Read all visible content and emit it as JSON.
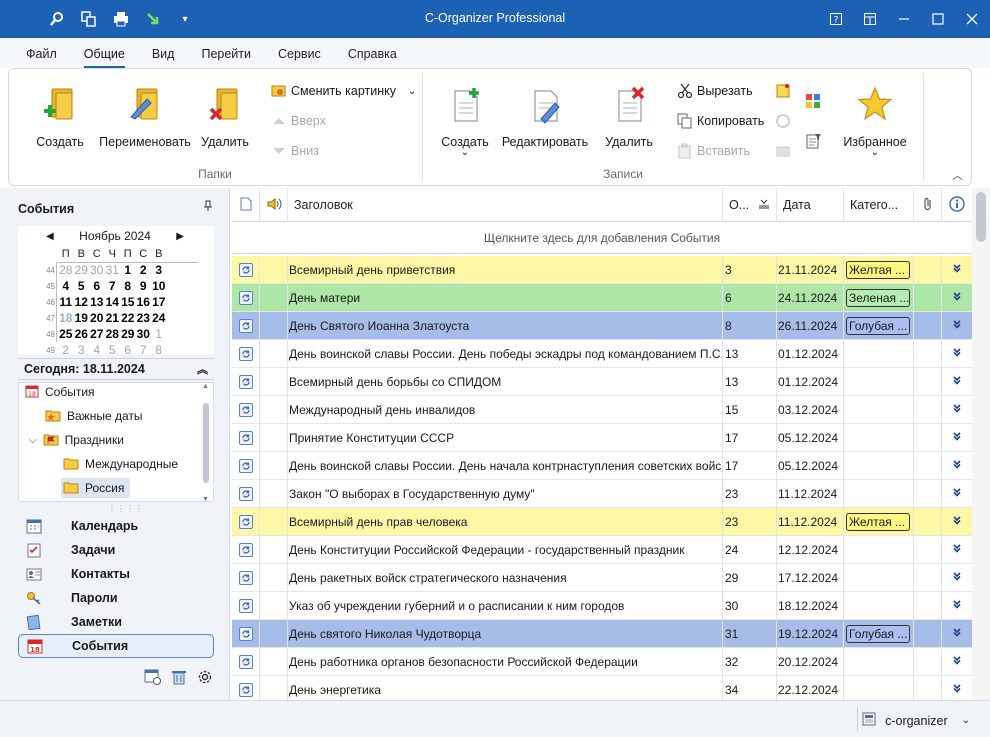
{
  "window": {
    "title": "C-Organizer Professional"
  },
  "menu": [
    {
      "label": "Файл",
      "active": false
    },
    {
      "label": "Общие",
      "active": true
    },
    {
      "label": "Вид",
      "active": false
    },
    {
      "label": "Перейти",
      "active": false
    },
    {
      "label": "Сервис",
      "active": false
    },
    {
      "label": "Справка",
      "active": false
    }
  ],
  "ribbon": {
    "folders": {
      "label": "Папки",
      "create": "Создать",
      "rename": "Переименовать",
      "delete": "Удалить",
      "change_picture": "Сменить картинку",
      "up": "Вверх",
      "down": "Вниз"
    },
    "records": {
      "label": "Записи",
      "create": "Создать",
      "edit": "Редактировать",
      "delete": "Удалить",
      "cut": "Вырезать",
      "copy": "Копировать",
      "paste": "Вставить"
    },
    "favorites": "Избранное"
  },
  "left": {
    "title": "События",
    "calendar": {
      "month": "Ноябрь 2024",
      "weekdays": [
        "П",
        "В",
        "С",
        "Ч",
        "П",
        "С",
        "В"
      ],
      "weeks": [
        {
          "num": "44",
          "days": [
            [
              "28",
              "g"
            ],
            [
              "29",
              "g"
            ],
            [
              "30",
              "g"
            ],
            [
              "31",
              "g"
            ],
            [
              "1",
              "b"
            ],
            [
              "2",
              "b"
            ],
            [
              "3",
              "b"
            ]
          ]
        },
        {
          "num": "45",
          "days": [
            [
              "4",
              "b"
            ],
            [
              "5",
              "b"
            ],
            [
              "6",
              "b"
            ],
            [
              "7",
              "b"
            ],
            [
              "8",
              "b"
            ],
            [
              "9",
              "b"
            ],
            [
              "10",
              "b"
            ]
          ]
        },
        {
          "num": "46",
          "days": [
            [
              "11",
              "b"
            ],
            [
              "12",
              "b"
            ],
            [
              "13",
              "b"
            ],
            [
              "14",
              "b"
            ],
            [
              "15",
              "b"
            ],
            [
              "16",
              "b"
            ],
            [
              "17",
              "b"
            ]
          ]
        },
        {
          "num": "47",
          "days": [
            [
              "18",
              "t"
            ],
            [
              "19",
              "b"
            ],
            [
              "20",
              "b"
            ],
            [
              "21",
              "b"
            ],
            [
              "22",
              "b"
            ],
            [
              "23",
              "b"
            ],
            [
              "24",
              "b"
            ]
          ]
        },
        {
          "num": "48",
          "days": [
            [
              "25",
              "b"
            ],
            [
              "26",
              "b"
            ],
            [
              "27",
              "b"
            ],
            [
              "28",
              "b"
            ],
            [
              "29",
              "b"
            ],
            [
              "30",
              "b"
            ],
            [
              "1",
              "g"
            ]
          ]
        },
        {
          "num": "49",
          "days": [
            [
              "2",
              "g"
            ],
            [
              "3",
              "g"
            ],
            [
              "4",
              "g"
            ],
            [
              "5",
              "g"
            ],
            [
              "6",
              "g"
            ],
            [
              "7",
              "g"
            ],
            [
              "8",
              "g"
            ]
          ]
        }
      ]
    },
    "today": "Сегодня: 18.11.2024",
    "tree": {
      "events": "События",
      "important": "Важные даты",
      "holidays": "Праздники",
      "international": "Международные",
      "russia": "Россия"
    },
    "nav": [
      {
        "label": "Календарь",
        "selected": false
      },
      {
        "label": "Задачи",
        "selected": false
      },
      {
        "label": "Контакты",
        "selected": false
      },
      {
        "label": "Пароли",
        "selected": false
      },
      {
        "label": "Заметки",
        "selected": false
      },
      {
        "label": "События",
        "selected": true
      }
    ]
  },
  "grid": {
    "headers": {
      "title": "Заголовок",
      "order": "О...",
      "date": "Дата",
      "category": "Катего..."
    },
    "add_row": "Щелкните здесь для добавления События",
    "rows": [
      {
        "title": "Всемирный день приветствия",
        "order": "3",
        "date": "21.11.2024",
        "category": "Желтая ...",
        "color": "yellow"
      },
      {
        "title": "День матери",
        "order": "6",
        "date": "24.11.2024",
        "category": "Зеленая ...",
        "color": "green"
      },
      {
        "title": "День Святого Иоанна Златоуста",
        "order": "8",
        "date": "26.11.2024",
        "category": "Голубая ...",
        "color": "blue"
      },
      {
        "title": "День воинской славы России. День победы эскадры под командованием П.С. На...",
        "order": "13",
        "date": "01.12.2024",
        "category": "",
        "color": ""
      },
      {
        "title": "Всемирный день борьбы со СПИДОМ",
        "order": "13",
        "date": "01.12.2024",
        "category": "",
        "color": ""
      },
      {
        "title": "Международный день инвалидов",
        "order": "15",
        "date": "03.12.2024",
        "category": "",
        "color": ""
      },
      {
        "title": "Принятие Конституции СССР",
        "order": "17",
        "date": "05.12.2024",
        "category": "",
        "color": ""
      },
      {
        "title": "День воинской славы России. День начала контрнаступления советских войск п...",
        "order": "17",
        "date": "05.12.2024",
        "category": "",
        "color": ""
      },
      {
        "title": "Закон \"О выборах в Государственную думу\"",
        "order": "23",
        "date": "11.12.2024",
        "category": "",
        "color": ""
      },
      {
        "title": "Всемирный день прав человека",
        "order": "23",
        "date": "11.12.2024",
        "category": "Желтая ...",
        "color": "yellow"
      },
      {
        "title": "День Конституции Российской Федерации - государственный праздник",
        "order": "24",
        "date": "12.12.2024",
        "category": "",
        "color": ""
      },
      {
        "title": "День ракетных войск стратегического назначения",
        "order": "29",
        "date": "17.12.2024",
        "category": "",
        "color": ""
      },
      {
        "title": "Указ об учреждении губерний и о расписании к ним городов",
        "order": "30",
        "date": "18.12.2024",
        "category": "",
        "color": ""
      },
      {
        "title": "День святого Николая Чудотворца",
        "order": "31",
        "date": "19.12.2024",
        "category": "Голубая ...",
        "color": "blue"
      },
      {
        "title": "День работника органов безопасности Российской Федерации",
        "order": "32",
        "date": "20.12.2024",
        "category": "",
        "color": ""
      },
      {
        "title": "День энергетика",
        "order": "34",
        "date": "22.12.2024",
        "category": "",
        "color": ""
      }
    ]
  },
  "status": {
    "user": "c-organizer"
  }
}
